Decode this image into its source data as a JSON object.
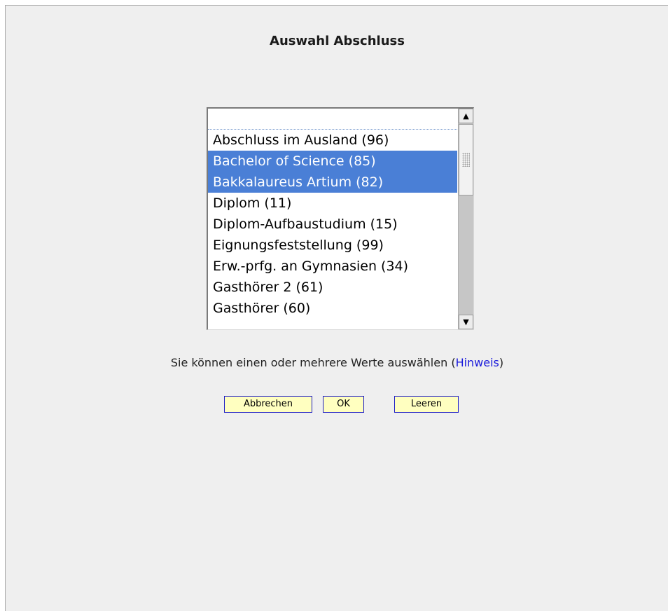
{
  "dialog": {
    "title": "Auswahl Abschluss"
  },
  "listbox": {
    "options": [
      {
        "label": "",
        "selected": false
      },
      {
        "label": "Abschluss im Ausland (96)",
        "selected": false
      },
      {
        "label": "Bachelor of Science (85)",
        "selected": true
      },
      {
        "label": "Bakkalaureus Artium (82)",
        "selected": true
      },
      {
        "label": "Diplom (11)",
        "selected": false
      },
      {
        "label": "Diplom-Aufbaustudium (15)",
        "selected": false
      },
      {
        "label": "Eignungsfeststellung (99)",
        "selected": false
      },
      {
        "label": "Erw.-prfg. an Gymnasien (34)",
        "selected": false
      },
      {
        "label": "Gasthörer 2 (61)",
        "selected": false
      },
      {
        "label": "Gasthörer (60)",
        "selected": false
      }
    ],
    "scroll_up_icon": "arrow-up-icon",
    "scroll_down_icon": "arrow-down-icon"
  },
  "hint": {
    "text_before": "Sie können einen oder mehrere Werte auswählen (",
    "link": "Hinweis",
    "text_after": ")"
  },
  "buttons": {
    "cancel": "Abbrechen",
    "ok": "OK",
    "clear": "Leeren"
  },
  "colors": {
    "selection": "#4a7fd6",
    "button_bg": "#ffffc0",
    "button_border": "#1c1cc4",
    "link": "#1a1adb"
  }
}
